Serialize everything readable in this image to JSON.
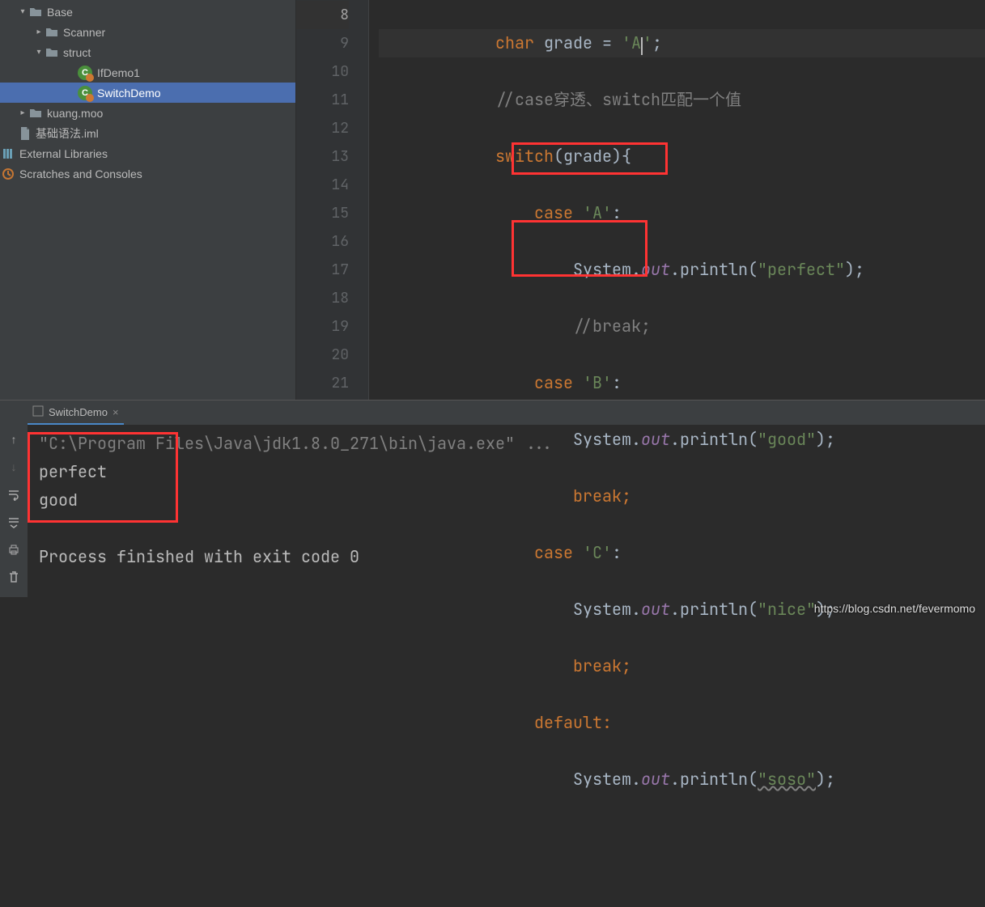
{
  "project": {
    "tree": {
      "base": "Base",
      "scanner": "Scanner",
      "struct": "struct",
      "ifdemo": "IfDemo1",
      "switchdemo": "SwitchDemo",
      "kuang": "kuang.moo",
      "iml": "基础语法.iml",
      "ext": "External Libraries",
      "scratches": "Scratches and Consoles"
    }
  },
  "editor": {
    "lines": [
      "8",
      "9",
      "10",
      "11",
      "12",
      "13",
      "14",
      "15",
      "16",
      "17",
      "18",
      "19",
      "20",
      "21"
    ],
    "code": {
      "l8": {
        "indent": "            ",
        "kw": "char",
        "var": " grade = ",
        "str1": "'A",
        "str2": "'",
        "semi": ";"
      },
      "l9": {
        "indent": "            ",
        "cmt": "//case穿透、switch匹配一个值"
      },
      "l10": {
        "indent": "            ",
        "kw": "switch",
        "rest": "(grade){"
      },
      "l11": {
        "indent": "                ",
        "kw": "case ",
        "str": "'A'",
        "colon": ":"
      },
      "l12": {
        "indent": "                    ",
        "cls": "System.",
        "it": "out",
        "dot": ".",
        "fn": "println",
        "p": "(",
        "str": "\"perfect\"",
        "end": ");"
      },
      "l13": {
        "indent": "                    ",
        "cmt": "//break;"
      },
      "l14": {
        "indent": "                ",
        "kw": "case ",
        "str": "'B'",
        "colon": ":"
      },
      "l15": {
        "indent": "                    ",
        "cls": "System.",
        "it": "out",
        "dot": ".",
        "fn": "println",
        "p": "(",
        "str": "\"good\"",
        "end": ");"
      },
      "l16": {
        "indent": "                    ",
        "kw": "break;"
      },
      "l17": {
        "indent": "                ",
        "kw": "case ",
        "str": "'C'",
        "colon": ":"
      },
      "l18": {
        "indent": "                    ",
        "cls": "System.",
        "it": "out",
        "dot": ".",
        "fn": "println",
        "p": "(",
        "str": "\"nice\"",
        "end": ");"
      },
      "l19": {
        "indent": "                    ",
        "kw": "break;"
      },
      "l20": {
        "indent": "                ",
        "kw": "default:"
      },
      "l21": {
        "indent": "                    ",
        "cls": "System.",
        "it": "out",
        "dot": ".",
        "fn": "println",
        "p": "(",
        "str": "\"soso\"",
        "end": ");"
      }
    }
  },
  "console": {
    "tab": "SwitchDemo",
    "cmd": "\"C:\\Program Files\\Java\\jdk1.8.0_271\\bin\\java.exe\" ...",
    "out1": "perfect",
    "out2": "good",
    "exit": "Process finished with exit code 0"
  },
  "watermark": "https://blog.csdn.net/fevermomo"
}
